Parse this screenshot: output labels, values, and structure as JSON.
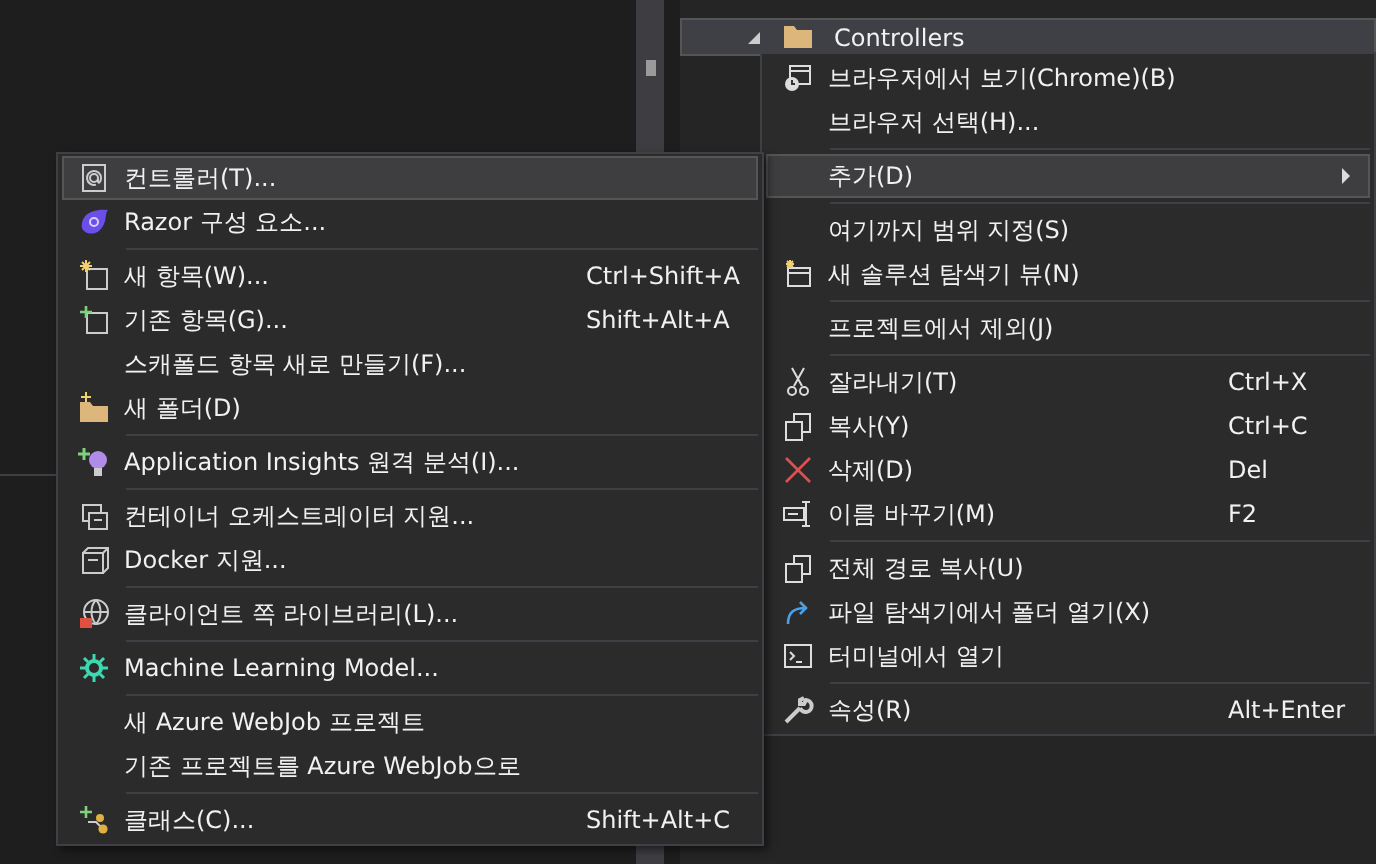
{
  "tree": {
    "items": [
      {
        "label": "Controllers",
        "selected": true,
        "expanded": true
      }
    ]
  },
  "context_menu": {
    "items": [
      {
        "kind": "item",
        "label": "브라우저에서 보기(Chrome)(B)",
        "selected": false
      },
      {
        "kind": "item",
        "label": "브라우저 선택(H)...",
        "selected": false
      },
      {
        "kind": "separator"
      },
      {
        "kind": "item",
        "label": "추가(D)",
        "selected": true,
        "submenu": true
      },
      {
        "kind": "separator"
      },
      {
        "kind": "item",
        "label": "여기까지 범위 지정(S)",
        "selected": false
      },
      {
        "kind": "item",
        "label": "새 솔루션 탐색기 뷰(N)",
        "selected": false
      },
      {
        "kind": "separator"
      },
      {
        "kind": "item",
        "label": "프로젝트에서 제외(J)",
        "selected": false
      },
      {
        "kind": "separator"
      },
      {
        "kind": "item",
        "label": "잘라내기(T)",
        "shortcut": "Ctrl+X",
        "selected": false
      },
      {
        "kind": "item",
        "label": "복사(Y)",
        "shortcut": "Ctrl+C",
        "selected": false
      },
      {
        "kind": "item",
        "label": "삭제(D)",
        "shortcut": "Del",
        "selected": false
      },
      {
        "kind": "item",
        "label": "이름 바꾸기(M)",
        "shortcut": "F2",
        "selected": false
      },
      {
        "kind": "separator"
      },
      {
        "kind": "item",
        "label": "전체 경로 복사(U)",
        "selected": false
      },
      {
        "kind": "item",
        "label": "파일 탐색기에서 폴더 열기(X)",
        "selected": false
      },
      {
        "kind": "item",
        "label": "터미널에서 열기",
        "selected": false
      },
      {
        "kind": "separator"
      },
      {
        "kind": "item",
        "label": "속성(R)",
        "shortcut": "Alt+Enter",
        "selected": false
      }
    ]
  },
  "add_submenu": {
    "items": [
      {
        "kind": "item",
        "label": "컨트롤러(T)...",
        "selected": true
      },
      {
        "kind": "item",
        "label": "Razor 구성 요소...",
        "selected": false
      },
      {
        "kind": "separator"
      },
      {
        "kind": "item",
        "label": "새 항목(W)...",
        "shortcut": "Ctrl+Shift+A",
        "selected": false
      },
      {
        "kind": "item",
        "label": "기존 항목(G)...",
        "shortcut": "Shift+Alt+A",
        "selected": false
      },
      {
        "kind": "item",
        "label": "스캐폴드 항목 새로 만들기(F)...",
        "selected": false
      },
      {
        "kind": "item",
        "label": "새 폴더(D)",
        "selected": false
      },
      {
        "kind": "separator"
      },
      {
        "kind": "item",
        "label": "Application Insights 원격 분석(I)...",
        "selected": false
      },
      {
        "kind": "separator"
      },
      {
        "kind": "item",
        "label": "컨테이너 오케스트레이터 지원...",
        "selected": false
      },
      {
        "kind": "item",
        "label": "Docker 지원...",
        "selected": false
      },
      {
        "kind": "separator"
      },
      {
        "kind": "item",
        "label": "클라이언트 쪽 라이브러리(L)...",
        "selected": false
      },
      {
        "kind": "separator"
      },
      {
        "kind": "item",
        "label": "Machine Learning Model...",
        "selected": false
      },
      {
        "kind": "separator"
      },
      {
        "kind": "item",
        "label": "새 Azure WebJob 프로젝트",
        "selected": false
      },
      {
        "kind": "item",
        "label": "기존 프로젝트를 Azure WebJob으로",
        "selected": false
      },
      {
        "kind": "separator"
      },
      {
        "kind": "item",
        "label": "클래스(C)...",
        "shortcut": "Shift+Alt+C",
        "selected": false
      }
    ]
  }
}
